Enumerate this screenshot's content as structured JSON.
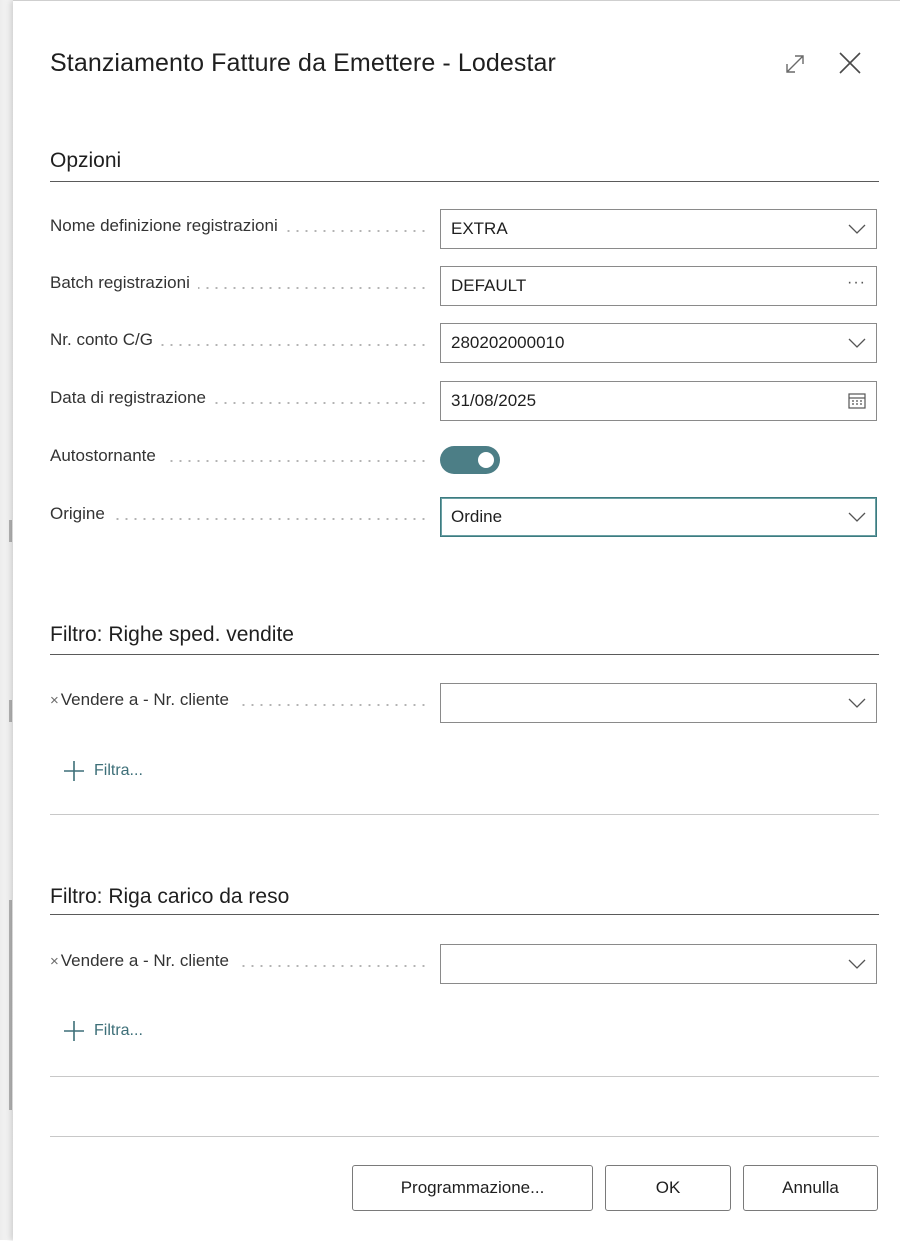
{
  "dialog": {
    "title": "Stanziamento Fatture da Emettere - Lodestar"
  },
  "options": {
    "section_title": "Opzioni",
    "fields": [
      {
        "label": "Nome definizione registrazioni",
        "value": "EXTRA",
        "icon": "chevron-down-icon"
      },
      {
        "label": "Batch registrazioni",
        "value": "DEFAULT",
        "icon": "ellipsis-icon",
        "icon_text": "···"
      },
      {
        "label": "Nr. conto C/G",
        "value": "280202000010",
        "icon": "chevron-down-icon"
      },
      {
        "label": "Data di registrazione",
        "value": "31/08/2025",
        "icon": "calendar-icon"
      },
      {
        "label": "Autostornante",
        "value": true,
        "icon": "toggle"
      },
      {
        "label": "Origine",
        "value": "Ordine",
        "icon": "chevron-down-icon",
        "focused": true
      }
    ]
  },
  "filter_shipments": {
    "section_title": "Filtro: Righe sped. vendite",
    "remove_mark": "×",
    "field_label": "Vendere a - Nr. cliente",
    "field_value": "",
    "add_filter_label": "Filtra..."
  },
  "filter_returns": {
    "section_title": "Filtro: Riga carico da reso",
    "remove_mark": "×",
    "field_label": "Vendere a - Nr. cliente",
    "field_value": "",
    "add_filter_label": "Filtra..."
  },
  "footer": {
    "schedule_label": "Programmazione...",
    "ok_label": "OK",
    "cancel_label": "Annulla"
  },
  "colors": {
    "accent": "#4c7e86",
    "link": "#3d6f78",
    "focus_border": "#3d7b80"
  }
}
